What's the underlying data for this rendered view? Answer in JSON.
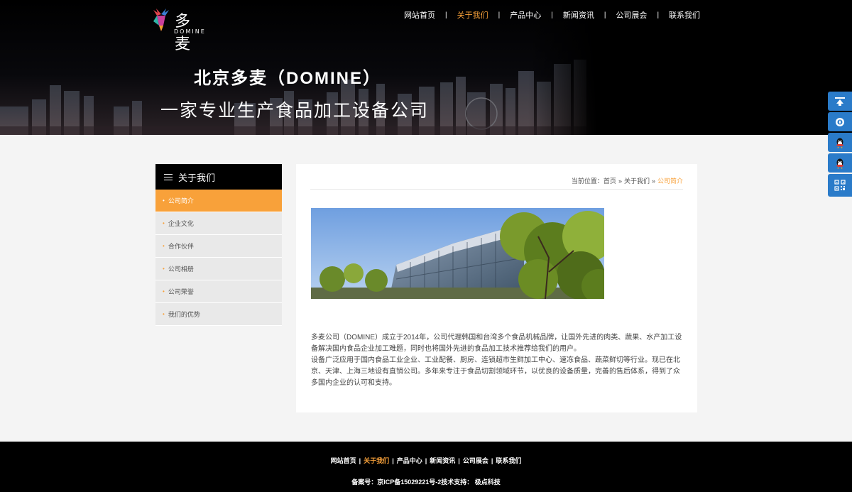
{
  "logo": {
    "text": "多麦",
    "sub": "DOMINE"
  },
  "nav": [
    {
      "label": "网站首页",
      "active": false
    },
    {
      "label": "关于我们",
      "active": true
    },
    {
      "label": "产品中心",
      "active": false
    },
    {
      "label": "新闻资讯",
      "active": false
    },
    {
      "label": "公司展会",
      "active": false
    },
    {
      "label": "联系我们",
      "active": false
    }
  ],
  "nav_sep": "|",
  "banner": {
    "title": "北京多麦（DOMINE）",
    "subtitle": "一家专业生产食品加工设备公司"
  },
  "sidebar": {
    "title": "关于我们",
    "items": [
      {
        "label": "公司简介",
        "active": true
      },
      {
        "label": "企业文化",
        "active": false
      },
      {
        "label": "合作伙伴",
        "active": false
      },
      {
        "label": "公司相册",
        "active": false
      },
      {
        "label": "公司荣誉",
        "active": false
      },
      {
        "label": "我们的优势",
        "active": false
      }
    ]
  },
  "breadcrumb": {
    "prefix": "当前位置：",
    "home": "首页",
    "section": "关于我们",
    "current": "公司简介",
    "arrow": "»"
  },
  "content": {
    "paragraphs": [
      "多麦公司（DOMINE）成立于2014年，公司代理韩国和台湾多个食品机械品牌，让国外先进的肉类、蔬果、水产加工设备解决国内食品企业加工难题，同时也将国外先进的食品加工技术推荐给我们的用户。",
      "设备广泛应用于国内食品工业企业、工业配餐、厨房、连锁超市生鲜加工中心、速冻食品、蔬菜鲜切等行业。现已在北京、天津、上海三地设有直销公司。多年来专注于食品切割领域环节，以优良的设备质量，完善的售后体系，得到了众多国内企业的认可和支持。"
    ]
  },
  "footer": {
    "nav": [
      {
        "label": "网站首页",
        "active": false
      },
      {
        "label": "关于我们",
        "active": true
      },
      {
        "label": "产品中心",
        "active": false
      },
      {
        "label": "新闻资讯",
        "active": false
      },
      {
        "label": "公司展会",
        "active": false
      },
      {
        "label": "联系我们",
        "active": false
      }
    ],
    "sep": "|",
    "info": "备案号：京ICP备15029221号-2技术支持： 极点科技"
  },
  "tools": [
    "back-to-top-icon",
    "chat-icon",
    "qq-icon",
    "qq-icon",
    "qr-code-icon"
  ],
  "colors": {
    "accent": "#f8a13a",
    "tool_blue": "#2a7bc9",
    "header_bg": "#000000"
  }
}
